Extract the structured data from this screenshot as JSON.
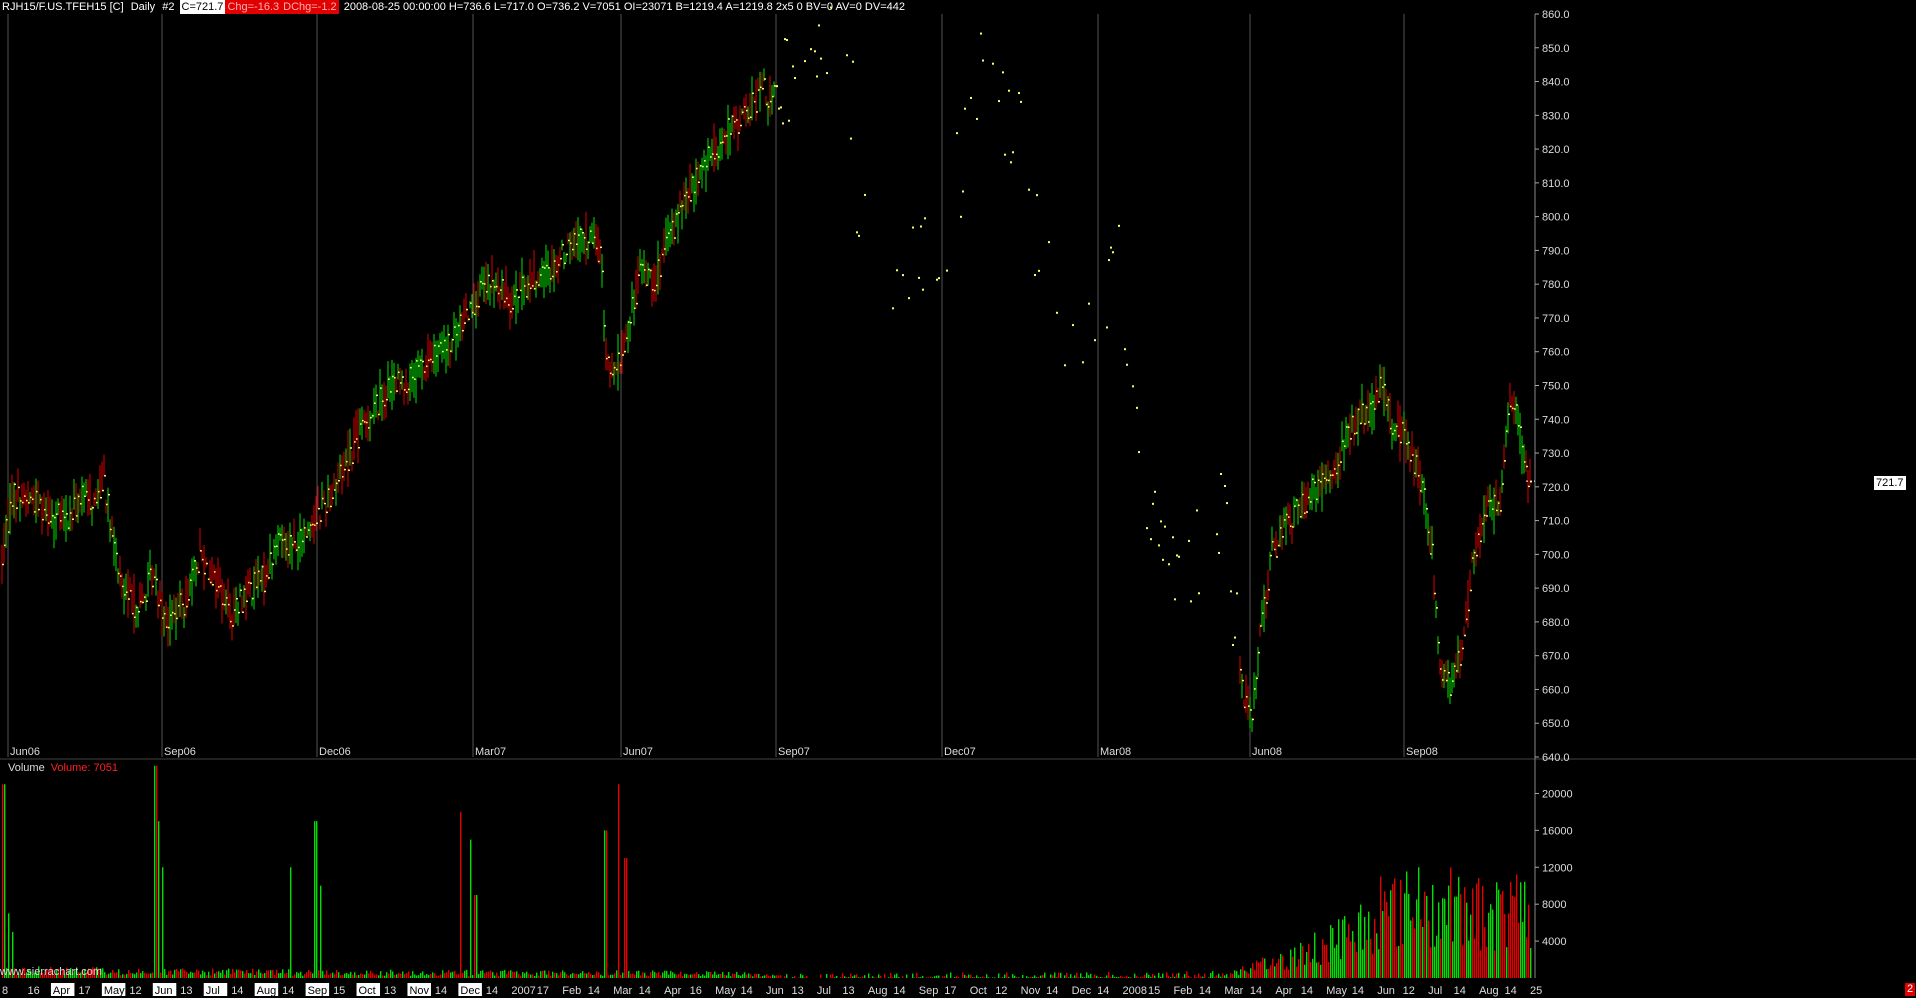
{
  "header": {
    "symbol": "RJH15/F.US.TFEH15 [C]",
    "period": "Daily",
    "chart_no": "#2",
    "close_box": "C=721.7",
    "chg_box": "Chg=-16.3",
    "dchg_box": "DChg=-1.2",
    "details": "2008-08-25 00:00:00 H=736.6 L=717.0 O=736.2 V=7051 OI=23071 B=1219.4 A=1219.8 2x5 0 BV=0 AV=0 DV=442"
  },
  "volume_panel": {
    "title": "Volume",
    "value_label": "Volume: 7051"
  },
  "watermark": "www.sierrachart.com",
  "last_price_label": "721.7",
  "corner_tag": "2",
  "chart_data": [
    {
      "type": "bar",
      "name": "price",
      "ylim": [
        640,
        860
      ],
      "yticks": [
        640.0,
        650.0,
        660.0,
        670.0,
        680.0,
        690.0,
        700.0,
        710.0,
        720.0,
        730.0,
        740.0,
        750.0,
        760.0,
        770.0,
        780.0,
        790.0,
        800.0,
        810.0,
        820.0,
        830.0,
        840.0,
        850.0,
        860.0
      ],
      "period_labels": [
        "Jun06",
        "Sep06",
        "Dec06",
        "Mar07",
        "Jun07",
        "Sep07",
        "Dec07",
        "Mar08",
        "Jun08",
        "Sep08"
      ],
      "grid": "vertical",
      "colors": {
        "up": "#00e000",
        "down": "#e00000",
        "tick": "#ffff66",
        "grid": "#555555"
      },
      "path_anchors": [
        [
          0,
          695
        ],
        [
          12,
          718
        ],
        [
          36,
          716
        ],
        [
          52,
          712
        ],
        [
          68,
          710
        ],
        [
          80,
          717
        ],
        [
          96,
          716
        ],
        [
          104,
          724
        ],
        [
          112,
          704
        ],
        [
          124,
          688
        ],
        [
          140,
          684
        ],
        [
          152,
          694
        ],
        [
          168,
          680
        ],
        [
          184,
          686
        ],
        [
          200,
          700
        ],
        [
          216,
          692
        ],
        [
          232,
          682
        ],
        [
          248,
          690
        ],
        [
          264,
          693
        ],
        [
          280,
          706
        ],
        [
          296,
          702
        ],
        [
          312,
          710
        ],
        [
          330,
          718
        ],
        [
          350,
          730
        ],
        [
          370,
          742
        ],
        [
          390,
          750
        ],
        [
          410,
          752
        ],
        [
          430,
          758
        ],
        [
          450,
          762
        ],
        [
          470,
          774
        ],
        [
          490,
          780
        ],
        [
          510,
          776
        ],
        [
          530,
          780
        ],
        [
          550,
          784
        ],
        [
          570,
          792
        ],
        [
          588,
          794
        ],
        [
          600,
          790
        ],
        [
          606,
          760
        ],
        [
          614,
          752
        ],
        [
          626,
          764
        ],
        [
          640,
          784
        ],
        [
          656,
          782
        ],
        [
          672,
          796
        ],
        [
          690,
          808
        ],
        [
          710,
          818
        ],
        [
          730,
          826
        ],
        [
          750,
          832
        ],
        [
          762,
          838
        ],
        [
          772,
          834
        ],
        [
          790,
          844
        ],
        [
          805,
          838
        ],
        [
          820,
          846
        ],
        [
          835,
          852
        ],
        [
          850,
          840
        ],
        [
          856,
          812
        ],
        [
          870,
          778
        ],
        [
          885,
          770
        ],
        [
          900,
          782
        ],
        [
          915,
          790
        ],
        [
          930,
          788
        ],
        [
          945,
          784
        ],
        [
          955,
          812
        ],
        [
          970,
          826
        ],
        [
          985,
          846
        ],
        [
          1000,
          832
        ],
        [
          1015,
          826
        ],
        [
          1030,
          800
        ],
        [
          1045,
          786
        ],
        [
          1060,
          766
        ],
        [
          1075,
          760
        ],
        [
          1090,
          762
        ],
        [
          1105,
          772
        ],
        [
          1120,
          784
        ],
        [
          1130,
          758
        ],
        [
          1140,
          720
        ],
        [
          1155,
          704
        ],
        [
          1170,
          696
        ],
        [
          1185,
          704
        ],
        [
          1200,
          702
        ],
        [
          1215,
          708
        ],
        [
          1222,
          718
        ],
        [
          1232,
          685
        ],
        [
          1242,
          660
        ],
        [
          1252,
          652
        ],
        [
          1262,
          682
        ],
        [
          1272,
          700
        ],
        [
          1282,
          708
        ],
        [
          1295,
          712
        ],
        [
          1310,
          718
        ],
        [
          1325,
          722
        ],
        [
          1340,
          730
        ],
        [
          1355,
          740
        ],
        [
          1370,
          742
        ],
        [
          1382,
          750
        ],
        [
          1392,
          738
        ],
        [
          1402,
          736
        ],
        [
          1412,
          730
        ],
        [
          1422,
          720
        ],
        [
          1432,
          700
        ],
        [
          1440,
          668
        ],
        [
          1450,
          660
        ],
        [
          1460,
          670
        ],
        [
          1470,
          692
        ],
        [
          1480,
          708
        ],
        [
          1490,
          714
        ],
        [
          1500,
          716
        ],
        [
          1510,
          745
        ],
        [
          1518,
          740
        ],
        [
          1524,
          728
        ],
        [
          1530,
          721.7
        ]
      ],
      "sparse_ranges": [
        [
          775,
          1240
        ]
      ]
    },
    {
      "type": "bar",
      "name": "volume",
      "ylim": [
        0,
        22000
      ],
      "yticks": [
        4000,
        8000,
        12000,
        16000,
        20000
      ],
      "colors": {
        "up": "#00e000",
        "down": "#e00000"
      },
      "spikes": [
        [
          3,
          21000
        ],
        [
          8,
          7000
        ],
        [
          12,
          5000
        ],
        [
          155,
          23000
        ],
        [
          158,
          17000
        ],
        [
          162,
          12000
        ],
        [
          290,
          12000
        ],
        [
          315,
          17000
        ],
        [
          320,
          10000
        ],
        [
          460,
          18000
        ],
        [
          470,
          15000
        ],
        [
          475,
          9000
        ],
        [
          605,
          16000
        ],
        [
          618,
          21000
        ],
        [
          625,
          13000
        ],
        [
          1380,
          11000
        ],
        [
          1418,
          12000
        ],
        [
          1450,
          12000
        ],
        [
          1490,
          8000
        ],
        [
          1508,
          7000
        ],
        [
          1518,
          6000
        ]
      ],
      "baseline_levels": [
        [
          0,
          900
        ],
        [
          120,
          700
        ],
        [
          300,
          600
        ],
        [
          700,
          500
        ],
        [
          780,
          300
        ],
        [
          1230,
          500
        ],
        [
          1300,
          2500
        ],
        [
          1350,
          5000
        ],
        [
          1400,
          7500
        ],
        [
          1460,
          7000
        ],
        [
          1530,
          7051
        ]
      ]
    }
  ],
  "time_axis": {
    "labels": [
      "8",
      "16",
      "Apr",
      "17",
      "May",
      "12",
      "Jun",
      "13",
      "Jul",
      "14",
      "Aug",
      "14",
      "Sep",
      "15",
      "Oct",
      "13",
      "Nov",
      "14",
      "Dec",
      "14",
      "2007",
      "17",
      "Feb",
      "14",
      "Mar",
      "14",
      "Apr",
      "16",
      "May",
      "14",
      "Jun",
      "13",
      "Jul",
      "13",
      "Aug",
      "14",
      "Sep",
      "17",
      "Oct",
      "12",
      "Nov",
      "14",
      "Dec",
      "14",
      "2008",
      "15",
      "Feb",
      "14",
      "Mar",
      "14",
      "Apr",
      "14",
      "May",
      "14",
      "Jun",
      "12",
      "Jul",
      "14",
      "Aug",
      "14",
      "25"
    ],
    "boxed": [
      "Apr",
      "May",
      "Jun",
      "Jul",
      "Aug",
      "Sep",
      "Oct",
      "Nov",
      "Dec",
      "2007",
      "Feb",
      "Mar",
      "Apr",
      "May",
      "Jun",
      "Jul",
      "Aug",
      "Sep",
      "Oct",
      "Nov",
      "Dec",
      "2008",
      "Feb",
      "Mar",
      "Apr",
      "May",
      "Jun",
      "Jul",
      "Aug"
    ]
  }
}
